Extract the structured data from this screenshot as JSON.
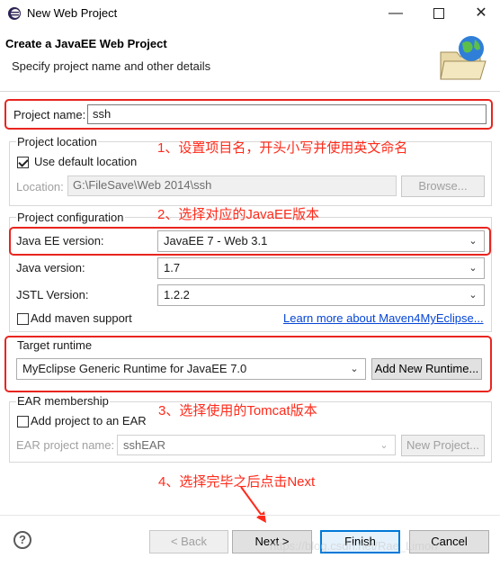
{
  "window": {
    "title": "New Web Project"
  },
  "header": {
    "title": "Create a JavaEE Web Project",
    "subtitle": "Specify project name and other details"
  },
  "project_name": {
    "label": "Project name:",
    "value": "ssh"
  },
  "project_location": {
    "group_label": "Project location",
    "use_default_label": "Use default location",
    "use_default_checked": true,
    "location_label": "Location:",
    "location_value": "G:\\FileSave\\Web 2014\\ssh",
    "browse_label": "Browse..."
  },
  "project_configuration": {
    "group_label": "Project configuration",
    "javaee_label": "Java EE version:",
    "javaee_value": "JavaEE 7 - Web 3.1",
    "java_label": "Java version:",
    "java_value": "1.7",
    "jstl_label": "JSTL Version:",
    "jstl_value": "1.2.2",
    "maven_label": "Add maven support",
    "maven_link": "Learn more about Maven4MyEclipse..."
  },
  "target_runtime": {
    "group_label": "Target runtime",
    "runtime_value": "MyEclipse Generic Runtime for JavaEE 7.0",
    "add_runtime_label": "Add New Runtime..."
  },
  "ear_membership": {
    "group_label": "EAR membership",
    "add_to_ear_label": "Add project to an EAR",
    "ear_project_label": "EAR project name:",
    "ear_project_value": "sshEAR",
    "new_project_label": "New Project..."
  },
  "annotations": {
    "a1": "1、设置项目名，开头小写并使用英文命名",
    "a2": "2、选择对应的JavaEE版本",
    "a3": "3、选择使用的Tomcat版本",
    "a4": "4、选择完毕之后点击Next"
  },
  "footer": {
    "help_icon": "?",
    "back_label": "< Back",
    "next_label": "Next >",
    "finish_label": "Finish",
    "cancel_label": "Cancel",
    "watermark": "https://blog.csdn.net/Rae_Limon"
  },
  "colors": {
    "annotation": "#e8251f",
    "link": "#0645d6",
    "focus": "#0078d7"
  }
}
